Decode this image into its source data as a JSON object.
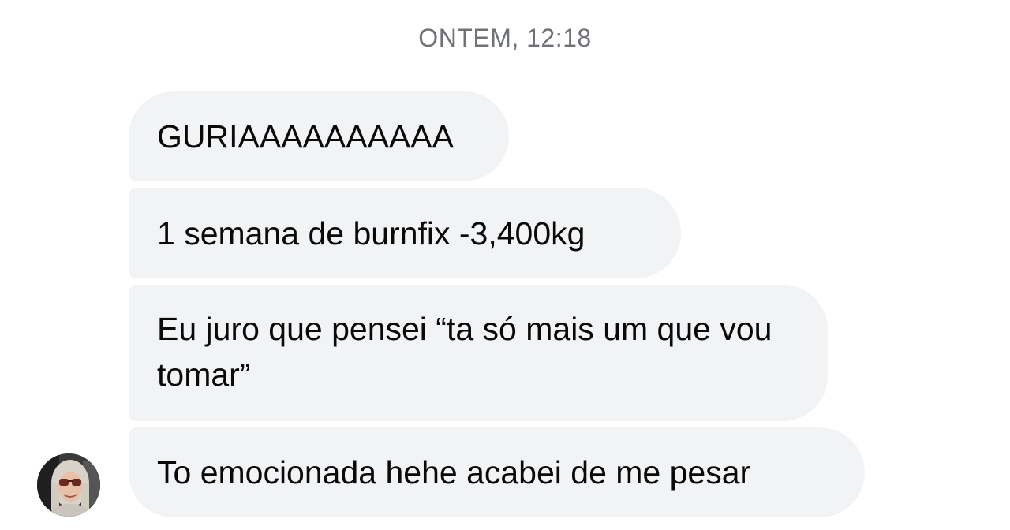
{
  "conversation": {
    "timestamp": "ONTEM, 12:18",
    "messages": [
      {
        "text": "GURIAAAAAAAAAA"
      },
      {
        "text": "1 semana de burnfix -3,400kg"
      },
      {
        "text": "Eu juro que pensei “ta só mais um que vou tomar”"
      },
      {
        "text": "To emocionada hehe acabei de me pesar"
      }
    ]
  },
  "sender": {
    "avatar_icon": "avatar-photo-woman-sunglasses"
  },
  "colors": {
    "bubble_background": "#f2f3f5",
    "timestamp_text": "#6f7276",
    "message_text": "#0a0a0a",
    "page_background": "#ffffff"
  }
}
